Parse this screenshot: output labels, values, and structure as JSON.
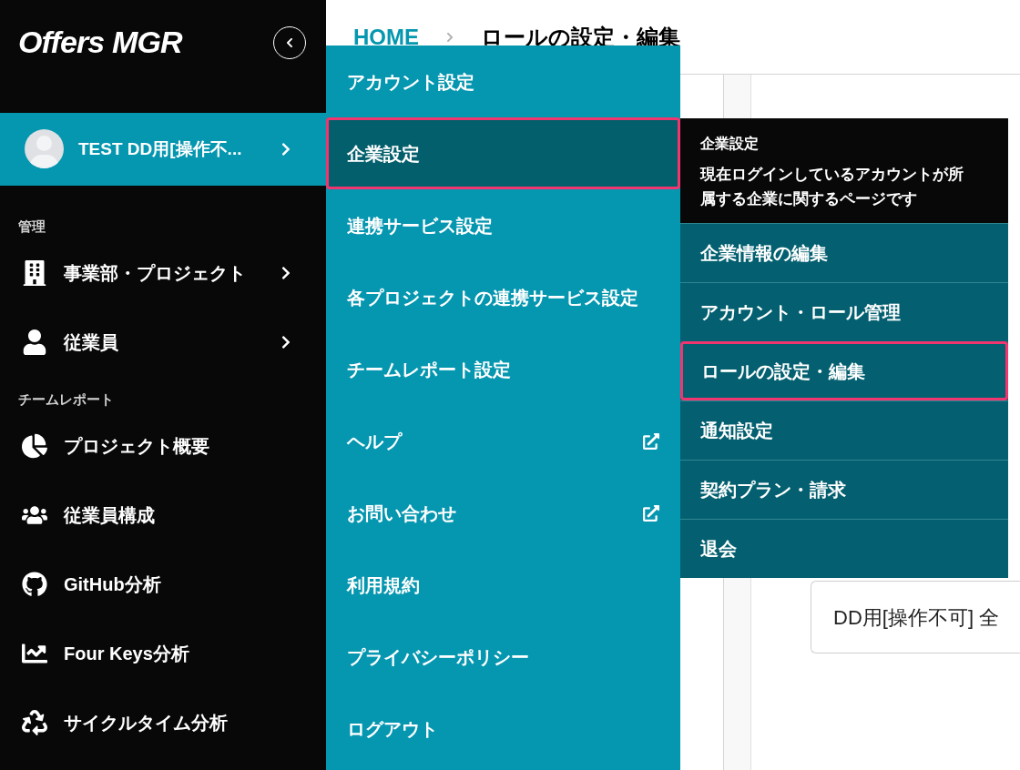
{
  "logo": "Offers MGR",
  "user": {
    "name": "TEST DD用[操作不..."
  },
  "sidebar": {
    "sections": [
      {
        "label": "管理",
        "items": [
          {
            "label": "事業部・プロジェクト",
            "expandable": true
          },
          {
            "label": "従業員",
            "expandable": true
          }
        ]
      },
      {
        "label": "チームレポート",
        "items": [
          {
            "label": "プロジェクト概要",
            "expandable": false
          },
          {
            "label": "従業員構成",
            "expandable": false
          },
          {
            "label": "GitHub分析",
            "expandable": false
          },
          {
            "label": "Four Keys分析",
            "expandable": false
          },
          {
            "label": "サイクルタイム分析",
            "expandable": false
          }
        ]
      }
    ]
  },
  "breadcrumb": [
    "HOME",
    "ロールの設定・編集"
  ],
  "card_text": "DD用[操作不可] 全",
  "menu": [
    {
      "label": "アカウント設定",
      "selected": false,
      "external": false
    },
    {
      "label": "企業設定",
      "selected": true,
      "external": false
    },
    {
      "label": "連携サービス設定",
      "selected": false,
      "external": false
    },
    {
      "label": "各プロジェクトの連携サービス設定",
      "selected": false,
      "external": false
    },
    {
      "label": "チームレポート設定",
      "selected": false,
      "external": false
    },
    {
      "label": "ヘルプ",
      "selected": false,
      "external": true
    },
    {
      "label": "お問い合わせ",
      "selected": false,
      "external": true
    },
    {
      "label": "利用規約",
      "selected": false,
      "external": false
    },
    {
      "label": "プライバシーポリシー",
      "selected": false,
      "external": false
    },
    {
      "label": "ログアウト",
      "selected": false,
      "external": false
    }
  ],
  "submenu": {
    "title": "企業設定",
    "description": "現在ログインしているアカウントが所属する企業に関するページです",
    "items": [
      {
        "label": "企業情報の編集",
        "selected": false
      },
      {
        "label": "アカウント・ロール管理",
        "selected": false
      },
      {
        "label": "ロールの設定・編集",
        "selected": true
      },
      {
        "label": "通知設定",
        "selected": false
      },
      {
        "label": "契約プラン・請求",
        "selected": false
      },
      {
        "label": "退会",
        "selected": false
      }
    ]
  }
}
